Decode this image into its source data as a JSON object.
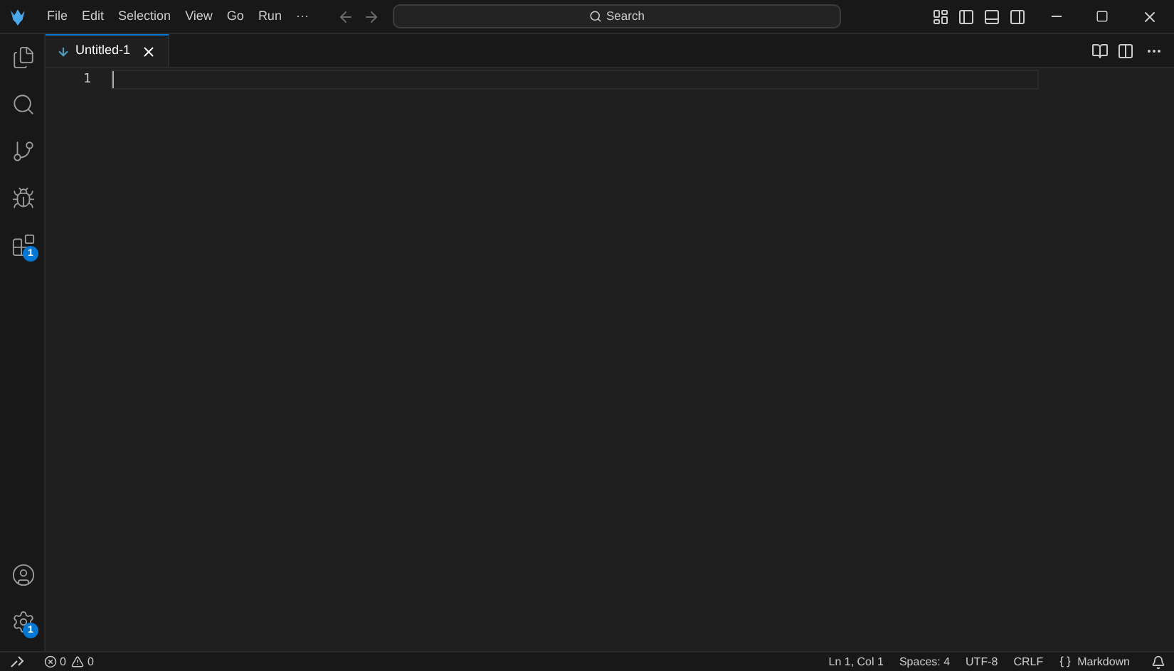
{
  "menu": [
    "File",
    "Edit",
    "Selection",
    "View",
    "Go",
    "Run",
    "···"
  ],
  "search": {
    "placeholder": "Search"
  },
  "activity_bar": [
    {
      "kind": "explorer"
    },
    {
      "kind": "search"
    },
    {
      "kind": "source-control"
    },
    {
      "kind": "run-debug"
    },
    {
      "kind": "extensions",
      "badge": "1"
    }
  ],
  "activity_bottom": [
    {
      "kind": "accounts"
    },
    {
      "kind": "manage",
      "badge": "1"
    }
  ],
  "tabs": [
    {
      "label": "Untitled-1",
      "selected": true
    }
  ],
  "editor": {
    "line_numbers": [
      "1"
    ]
  },
  "status_bar": {
    "errors": "0",
    "warnings": "0",
    "right": [
      "Ln 1, Col 1",
      "Spaces: 4",
      "UTF-8",
      "CRLF",
      "Markdown"
    ]
  }
}
